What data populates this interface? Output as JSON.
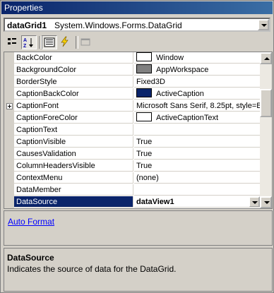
{
  "window": {
    "title": "Properties"
  },
  "object_selector": {
    "name": "dataGrid1",
    "type": "System.Windows.Forms.DataGrid"
  },
  "toolbar": {
    "buttons": [
      {
        "icon": "categorized-icon"
      },
      {
        "icon": "alphabetical-icon"
      },
      {
        "icon": "properties-icon"
      },
      {
        "icon": "events-icon"
      },
      {
        "icon": "property-pages-icon"
      }
    ]
  },
  "grid": {
    "rows": [
      {
        "name": "BackColor",
        "value": "Window",
        "swatch": "#ffffff"
      },
      {
        "name": "BackgroundColor",
        "value": "AppWorkspace",
        "swatch": "#808080"
      },
      {
        "name": "BorderStyle",
        "value": "Fixed3D"
      },
      {
        "name": "CaptionBackColor",
        "value": "ActiveCaption",
        "swatch": "#0a246a"
      },
      {
        "name": "CaptionFont",
        "value": "Microsoft Sans Serif, 8.25pt, style=B",
        "expandable": true
      },
      {
        "name": "CaptionForeColor",
        "value": "ActiveCaptionText",
        "swatch": "#ffffff"
      },
      {
        "name": "CaptionText",
        "value": ""
      },
      {
        "name": "CaptionVisible",
        "value": "True"
      },
      {
        "name": "CausesValidation",
        "value": "True"
      },
      {
        "name": "ColumnHeadersVisible",
        "value": "True"
      },
      {
        "name": "ContextMenu",
        "value": "(none)"
      },
      {
        "name": "DataMember",
        "value": ""
      },
      {
        "name": "DataSource",
        "value": "dataView1",
        "selected": true
      }
    ]
  },
  "verbs": {
    "auto_format": "Auto Format"
  },
  "description": {
    "title": "DataSource",
    "text": "Indicates the source of data for the DataGrid."
  }
}
